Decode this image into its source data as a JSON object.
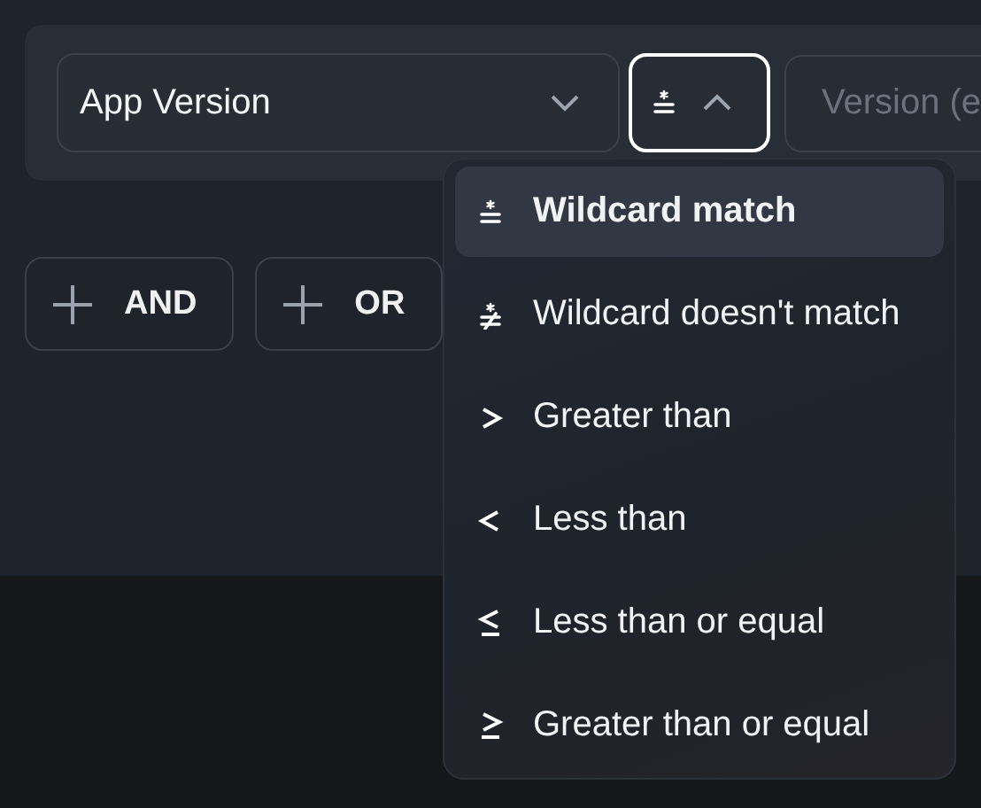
{
  "condition": {
    "field": {
      "value": "App Version"
    },
    "operator": {
      "kind": "wildcard",
      "expanded": true
    },
    "value_input": {
      "placeholder": "Version (e"
    }
  },
  "add_buttons": [
    {
      "label": "AND"
    },
    {
      "label": "OR"
    }
  ],
  "operator_menu": [
    {
      "kind": "wildcard",
      "label": "Wildcard match",
      "selected": true
    },
    {
      "kind": "notwildcard",
      "label": "Wildcard doesn't match",
      "selected": false
    },
    {
      "kind": "gt",
      "label": "Greater than",
      "selected": false
    },
    {
      "kind": "lt",
      "label": "Less than",
      "selected": false
    },
    {
      "kind": "lte",
      "label": "Less than or equal",
      "selected": false
    },
    {
      "kind": "gte",
      "label": "Greater than or equal",
      "selected": false
    }
  ]
}
